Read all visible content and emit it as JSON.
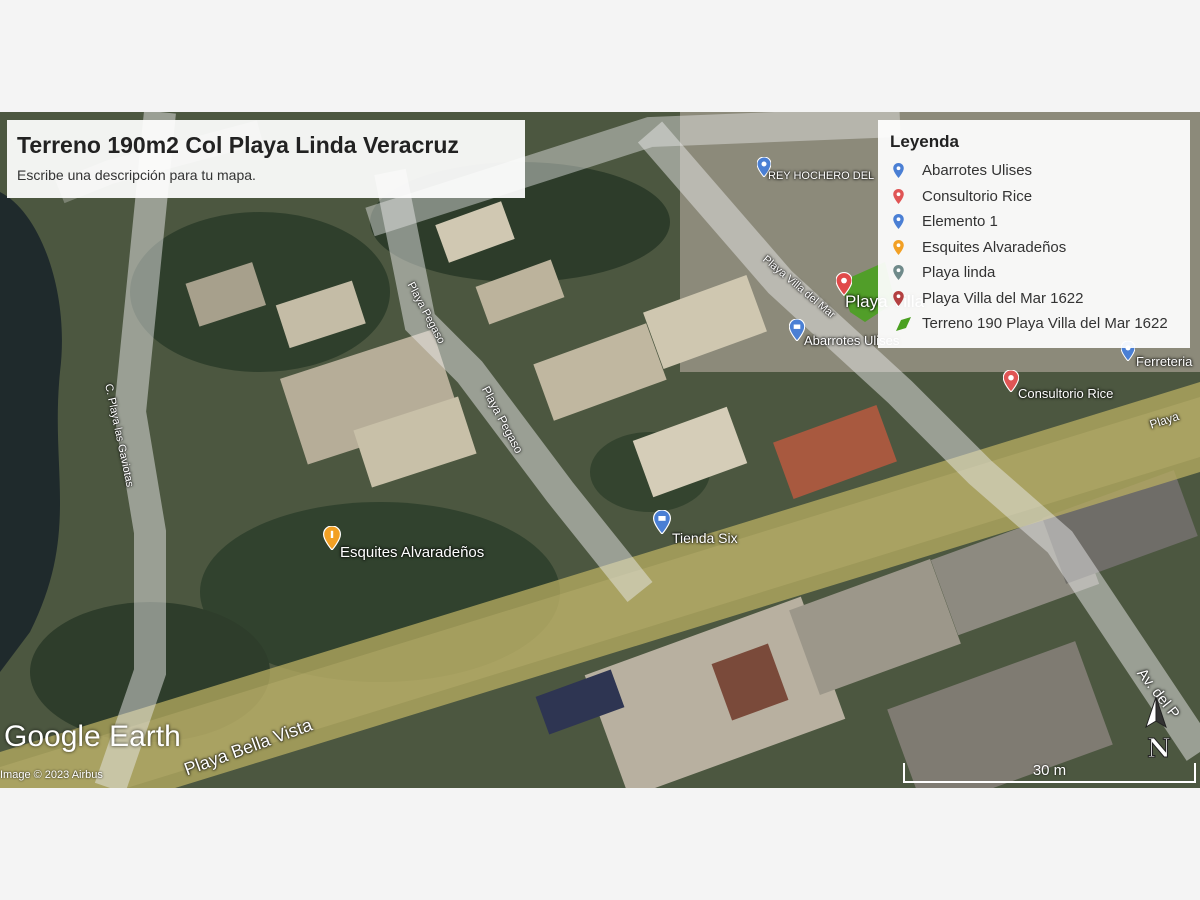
{
  "map": {
    "title": "Terreno 190m2 Col Playa Linda Veracruz",
    "description": "Escribe una descripción para tu mapa.",
    "legend_title": "Leyenda",
    "legend": [
      {
        "label": "Abarrotes Ulises",
        "icon": "blue-pin-icon",
        "color": "#4a7fd4"
      },
      {
        "label": "Consultorio Rice",
        "icon": "red-pin-icon",
        "color": "#e05555"
      },
      {
        "label": "Elemento 1",
        "icon": "blue-pin-icon",
        "color": "#4a7fd4"
      },
      {
        "label": "Esquites Alvaradeños",
        "icon": "orange-pin-icon",
        "color": "#f2a024"
      },
      {
        "label": "Playa linda",
        "icon": "gray-pin-icon",
        "color": "#6f8a8a"
      },
      {
        "label": "Playa Villa del Mar 1622",
        "icon": "darkred-pin-icon",
        "color": "#b34040"
      },
      {
        "label": "Terreno 190 Playa Villa del Mar 1622",
        "icon": "green-polygon-icon",
        "color": "#4aa020"
      }
    ],
    "places": {
      "rey": "REY HOCHERO DEL",
      "playa_villa": "Playa Villa",
      "abarrotes": "Abarrotes Ulises",
      "ferreteria": "Ferreteria",
      "consultorio": "Consultorio Rice",
      "tienda": "Tienda Six",
      "esquites": "Esquites Alvaradeños"
    },
    "roads": {
      "bella_vista": "Playa Bella Vista",
      "gaviotas": "C. Playa las Gaviotas",
      "pegaso_upper": "Playa Pegaso",
      "pegaso_lower": "Playa Pegaso",
      "villa_mar": "Playa Villa del Mar",
      "av_del": "Av. del P",
      "playa_right": "Playa"
    },
    "logo": "Google Earth",
    "copyright": "Image © 2023 Airbus",
    "scale": "30 m",
    "north": "N"
  }
}
